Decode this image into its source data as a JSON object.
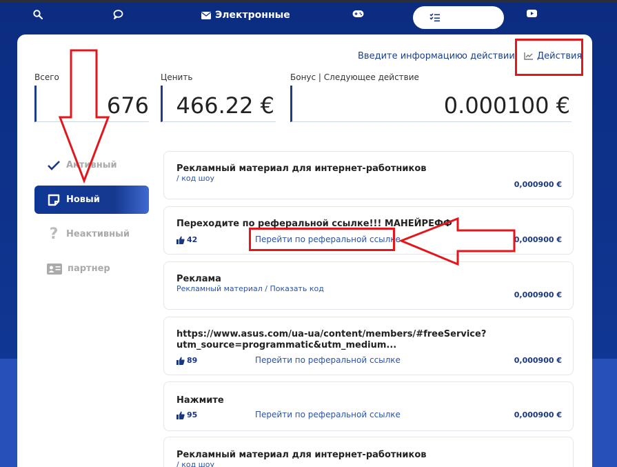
{
  "nav": {
    "electronic_label": "Электронные"
  },
  "header_links": {
    "enter_info": "Введите информацию",
    "about": "о действии",
    "actions": "Действия"
  },
  "stats": {
    "total_label": "Всего",
    "total_value": "676",
    "price_label": "Ценить",
    "price_value": "466.22 €",
    "bonus_label": "Бонус | Следующее действие",
    "bonus_value": "0.000100 €"
  },
  "sidebar": {
    "items": [
      {
        "label": "Активный"
      },
      {
        "label": "Новый"
      },
      {
        "label": "Неактивный"
      },
      {
        "label": "партнер"
      }
    ]
  },
  "tasks": [
    {
      "title": "Рекламный материал для интернет-работников",
      "sub": "/ код шоу",
      "price": "0,000900 €"
    },
    {
      "title": "Переходите по реферальной ссылке!!! МАНЕЙРЕФФ",
      "likes": "42",
      "ref": "Перейти по реферальной ссылке",
      "price": "0,000900 €"
    },
    {
      "title": "Реклама",
      "sub": "Рекламный материал / Показать код",
      "price": "0,000900 €"
    },
    {
      "title1": "https://www.asus.com/ua-ua/content/members/#freeService?",
      "title2": "utm_source=programmatic&utm_medium...",
      "likes": "89",
      "ref": "Перейти по реферальной ссылке",
      "price": "0,000900 €"
    },
    {
      "title": "Нажмите",
      "likes": "95",
      "ref": "Перейти по реферальной ссылке",
      "price": "0,000900 €"
    },
    {
      "title": "Рекламный материал для интернет-работников",
      "sub": "/ код шоу"
    }
  ],
  "colors": {
    "accent": "#1a3680",
    "annotation_red": "#e3161b",
    "background": "#0e2f86"
  }
}
